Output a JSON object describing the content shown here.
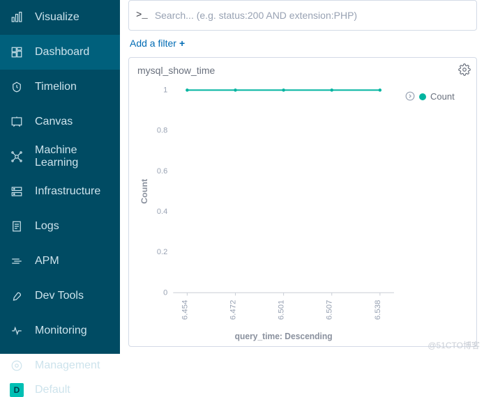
{
  "sidebar": {
    "items": [
      {
        "label": "Visualize",
        "name": "sidebar-item-visualize",
        "active": false
      },
      {
        "label": "Dashboard",
        "name": "sidebar-item-dashboard",
        "active": true
      },
      {
        "label": "Timelion",
        "name": "sidebar-item-timelion",
        "active": false
      },
      {
        "label": "Canvas",
        "name": "sidebar-item-canvas",
        "active": false
      },
      {
        "label": "Machine Learning",
        "name": "sidebar-item-machine-learning",
        "active": false
      },
      {
        "label": "Infrastructure",
        "name": "sidebar-item-infrastructure",
        "active": false
      },
      {
        "label": "Logs",
        "name": "sidebar-item-logs",
        "active": false
      },
      {
        "label": "APM",
        "name": "sidebar-item-apm",
        "active": false
      },
      {
        "label": "Dev Tools",
        "name": "sidebar-item-dev-tools",
        "active": false
      },
      {
        "label": "Monitoring",
        "name": "sidebar-item-monitoring",
        "active": false
      },
      {
        "label": "Management",
        "name": "sidebar-item-management",
        "active": false
      }
    ],
    "default_label": "Default",
    "default_badge": "D"
  },
  "search": {
    "prompt": ">_",
    "placeholder": "Search... (e.g. status:200 AND extension:PHP)"
  },
  "filters": {
    "add_label": "Add a filter",
    "plus": "+"
  },
  "panel": {
    "title": "mysql_show_time",
    "legend_label": "Count",
    "legend_color": "#00b4a0"
  },
  "chart_data": {
    "type": "line",
    "title": "mysql_show_time",
    "xlabel": "query_time: Descending",
    "ylabel": "Count",
    "ylim": [
      0,
      1
    ],
    "yticks": [
      0,
      0.2,
      0.4,
      0.6,
      0.8,
      1
    ],
    "categories": [
      "6.454",
      "6.472",
      "6.501",
      "6.507",
      "6.538"
    ],
    "series": [
      {
        "name": "Count",
        "color": "#00b4a0",
        "values": [
          1,
          1,
          1,
          1,
          1
        ]
      }
    ]
  },
  "watermark": "@51CTO博客"
}
